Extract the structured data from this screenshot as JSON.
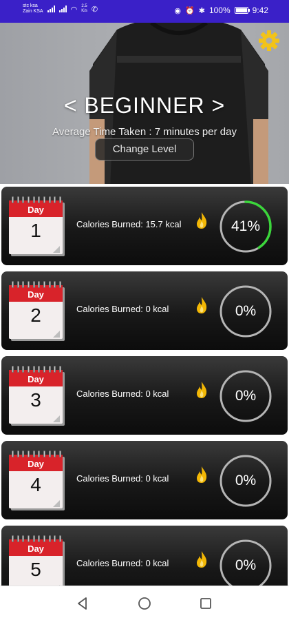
{
  "status_bar": {
    "carrier_line1": "stc ksa",
    "carrier_line2": "Zain KSA",
    "net_speed_value": "2.5",
    "net_speed_unit": "K/s",
    "battery": "100%",
    "time": "9:42",
    "battery_level": 1.0,
    "icons": [
      "signal-icon",
      "wifi-icon",
      "whatsapp-icon",
      "nfc-icon",
      "alarm-icon",
      "bluetooth-icon",
      "battery-icon"
    ]
  },
  "header": {
    "level_title": "< BEGINNER >",
    "avg_time": "Average Time Taken : 7 minutes per day",
    "change_level_label": "Change Level",
    "settings_icon": "gear-icon",
    "accent_color": "#f2c318"
  },
  "days": [
    {
      "day_label": "Day",
      "day_number": "1",
      "calories_text": "Calories Burned: 15.7 kcal",
      "progress_text": "41%",
      "progress": 0.41
    },
    {
      "day_label": "Day",
      "day_number": "2",
      "calories_text": "Calories Burned: 0 kcal",
      "progress_text": "0%",
      "progress": 0
    },
    {
      "day_label": "Day",
      "day_number": "3",
      "calories_text": "Calories Burned: 0 kcal",
      "progress_text": "0%",
      "progress": 0
    },
    {
      "day_label": "Day",
      "day_number": "4",
      "calories_text": "Calories Burned: 0 kcal",
      "progress_text": "0%",
      "progress": 0
    },
    {
      "day_label": "Day",
      "day_number": "5",
      "calories_text": "Calories Burned: 0 kcal",
      "progress_text": "0%",
      "progress": 0
    }
  ],
  "colors": {
    "status_bar": "#3a20c8",
    "progress_track": "#b5b5b5",
    "progress_fill": "#3bd63b",
    "calendar_red": "#d8232a",
    "flame": "#f2b705"
  },
  "nav": {
    "back_icon": "back-triangle-icon",
    "home_icon": "home-circle-icon",
    "recents_icon": "recents-square-icon"
  }
}
